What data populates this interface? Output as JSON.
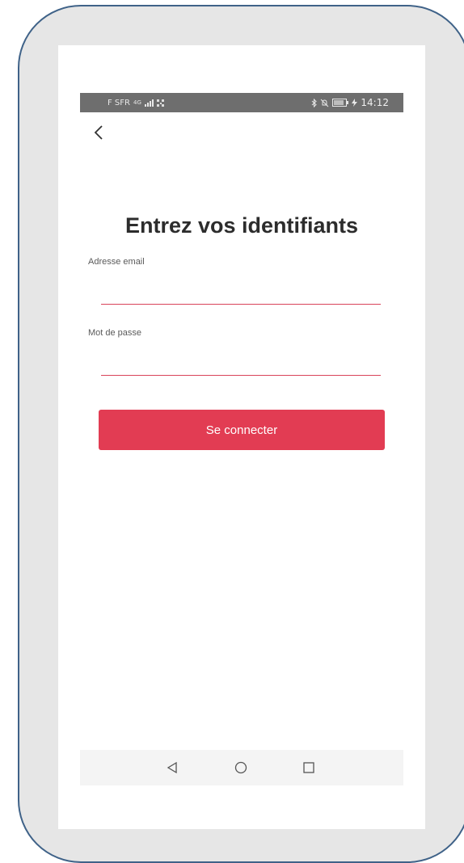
{
  "status_bar": {
    "carrier": "F SFR",
    "network": "4G",
    "time": "14:12",
    "battery": "82"
  },
  "header": {
    "back_icon": "chevron-left-icon"
  },
  "login": {
    "title": "Entrez vos identifiants",
    "email_label": "Adresse email",
    "email_value": "",
    "password_label": "Mot de passe",
    "password_value": "",
    "submit_label": "Se connecter"
  },
  "navigation": {
    "back": "triangle-back-icon",
    "home": "circle-home-icon",
    "recents": "square-recents-icon"
  },
  "colors": {
    "accent": "#e23c53",
    "frame_border": "#3f6288",
    "status_bar": "#6e6e6e"
  }
}
